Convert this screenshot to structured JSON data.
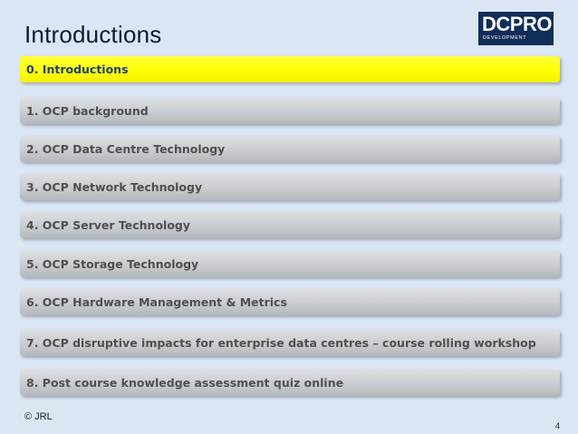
{
  "slide": {
    "title": "Introductions",
    "logo": {
      "main": "DCPRO",
      "sub": "DEVELOPMENT"
    },
    "agenda": [
      {
        "label": "0. Introductions",
        "active": true
      },
      {
        "label": "1. OCP background",
        "active": false
      },
      {
        "label": "2. OCP Data Centre Technology",
        "active": false
      },
      {
        "label": "3. OCP Network Technology",
        "active": false
      },
      {
        "label": "4. OCP Server Technology",
        "active": false
      },
      {
        "label": "5. OCP Storage Technology",
        "active": false
      },
      {
        "label": "6. OCP Hardware Management & Metrics",
        "active": false
      },
      {
        "label": "7. OCP disruptive impacts for enterprise data centres – course rolling workshop",
        "active": false
      },
      {
        "label": "8. Post course knowledge assessment quiz online",
        "active": false
      }
    ],
    "footer": {
      "copyright": "© JRL",
      "page_number": "4"
    }
  },
  "colors": {
    "background": "#dbe6f4",
    "highlight": "#ffff00",
    "highlight_text": "#1f3f8a",
    "item_text": "#4f4f4f",
    "logo_bg": "#0f2e5a"
  }
}
